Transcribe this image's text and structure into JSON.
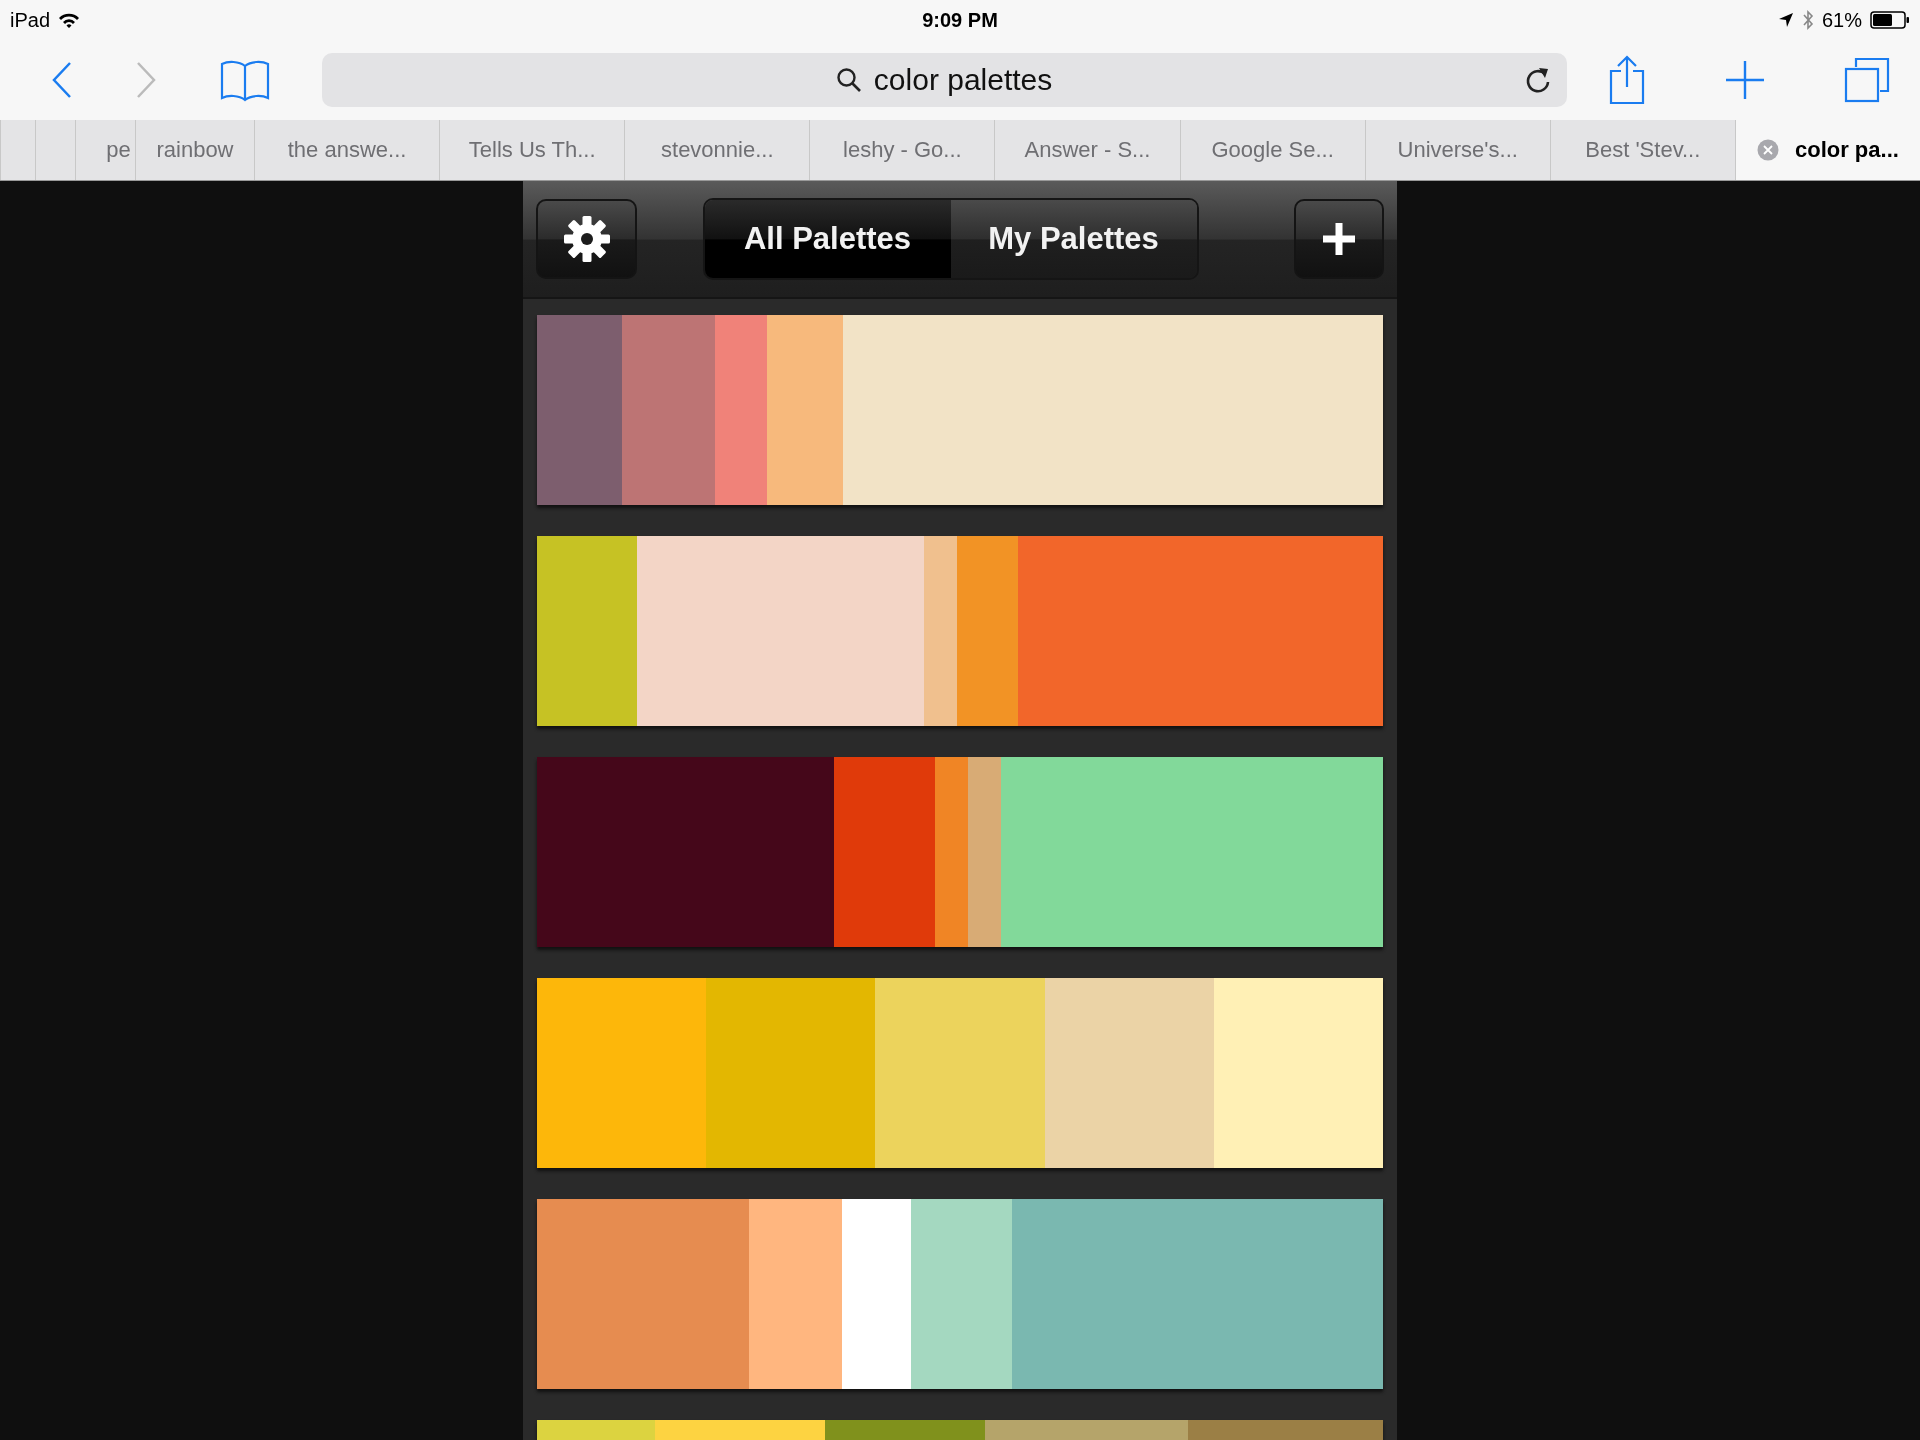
{
  "status_bar": {
    "device": "iPad",
    "time": "9:09 PM",
    "battery": "61%"
  },
  "toolbar": {
    "back_disabled": false,
    "forward_disabled": true,
    "address": "color palettes"
  },
  "tabs": [
    {
      "selected": false
    },
    {
      "selected": false
    },
    {
      "title": "pe",
      "selected": false
    },
    {
      "title": "rainbow",
      "selected": false
    },
    {
      "title": "the answe...",
      "selected": false
    },
    {
      "title": "Tells Us Th...",
      "selected": false
    },
    {
      "title": "stevonnie...",
      "selected": false
    },
    {
      "title": "leshy - Go...",
      "selected": false
    },
    {
      "title": "Answer - S...",
      "selected": false
    },
    {
      "title": "Google Se...",
      "selected": false
    },
    {
      "title": "Universe's...",
      "selected": false
    },
    {
      "title": "Best 'Stev...",
      "selected": false
    },
    {
      "title": "color pa...",
      "selected": true
    }
  ],
  "app": {
    "segments": [
      {
        "label": "All Palettes",
        "selected": true
      },
      {
        "label": "My Palettes",
        "selected": false
      }
    ],
    "palettes": [
      {
        "swatches": [
          {
            "color": "#7d5e6e"
          },
          {
            "color": "#bd7474"
          },
          {
            "color": "#f08279"
          },
          {
            "color": "#f7b97c"
          },
          {
            "color": "#f2e3c6"
          }
        ]
      },
      {
        "swatches": [
          {
            "color": "#c6c224"
          },
          {
            "color": "#f3d5c6"
          },
          {
            "color": "#f0c08e"
          },
          {
            "color": "#f29325"
          },
          {
            "color": "#f2662a"
          }
        ]
      },
      {
        "swatches": [
          {
            "color": "#45071a"
          },
          {
            "color": "#e03a0a"
          },
          {
            "color": "#f08525"
          },
          {
            "color": "#d8ab75"
          },
          {
            "color": "#82d99a"
          }
        ]
      },
      {
        "swatches": [
          {
            "color": "#fdb70a"
          },
          {
            "color": "#e3b701"
          },
          {
            "color": "#ecd35c"
          },
          {
            "color": "#ebd3a6"
          },
          {
            "color": "#fff0b5"
          }
        ]
      },
      {
        "swatches": [
          {
            "color": "#e68c50"
          },
          {
            "color": "#ffb67f"
          },
          {
            "color": "#ffffff"
          },
          {
            "color": "#a4d8c0"
          },
          {
            "color": "#7ab8b0"
          }
        ]
      },
      {
        "swatches": [
          {
            "color": "#dcd340"
          },
          {
            "color": "#fdd341"
          },
          {
            "color": "#80911c"
          },
          {
            "color": "#b5a46a"
          },
          {
            "color": "#9b7f45"
          }
        ]
      }
    ]
  }
}
